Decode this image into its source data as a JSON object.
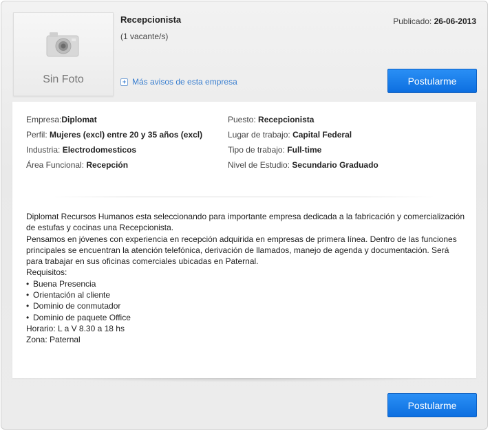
{
  "header": {
    "photo_label": "Sin Foto",
    "job_title": "Recepcionista",
    "vacancies": "(1 vacante/s)",
    "published_label": "Publicado:",
    "published_date": "26-06-2013",
    "more_link": "Más avisos de esta empresa",
    "apply_label": "Postularme"
  },
  "details": {
    "left": [
      {
        "label": "Empresa:",
        "value": "Diplomat"
      },
      {
        "label": "Perfil:",
        "value": "Mujeres (excl) entre 20 y 35 años (excl)"
      },
      {
        "label": "Industria:",
        "value": "Electrodomesticos"
      },
      {
        "label": "Área Funcional:",
        "value": "Recepción"
      }
    ],
    "right": [
      {
        "label": "Puesto:",
        "value": "Recepcionista"
      },
      {
        "label": "Lugar de trabajo:",
        "value": "Capital Federal"
      },
      {
        "label": "Tipo de trabajo:",
        "value": "Full-time"
      },
      {
        "label": "Nivel de Estudio:",
        "value": "Secundario Graduado"
      }
    ]
  },
  "description": {
    "p1": "Diplomat Recursos Humanos esta seleccionando para importante empresa dedicada a la fabricación y comercialización de estufas y cocinas una Recepcionista.",
    "p2": "Pensamos en jóvenes con experiencia en recepción adquirida en empresas de primera línea. Dentro de las funciones principales se encuentran la atención telefónica, derivación de llamados, manejo de agenda y documentación. Será para trabajar en sus oficinas comerciales ubicadas en Paternal.",
    "requirements_title": "Requisitos:",
    "requirements": [
      "Buena Presencia",
      "Orientación al cliente",
      "Dominio de conmutador",
      "Dominio de paquete Office"
    ],
    "schedule": "Horario: L a V 8.30 a 18 hs",
    "zone": "Zona: Paternal"
  },
  "footer": {
    "apply_label": "Postularme"
  },
  "colors": {
    "accent": "#1a7ef0",
    "link": "#3a7fd0"
  },
  "icons": {
    "photo": "camera-icon",
    "more": "plus-icon"
  }
}
